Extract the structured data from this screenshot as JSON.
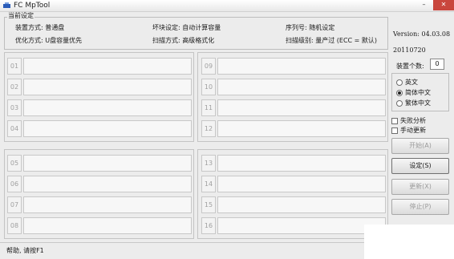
{
  "window": {
    "title": "FC MpTool",
    "minimize": "–",
    "close": "✕"
  },
  "settings": {
    "group_title": "当前设定",
    "row1": [
      "装置方式: 普通盘",
      "坏块设定: 自动计算容量",
      "序列号: 随机设定"
    ],
    "row2": [
      "优化方式: U盘容量优先",
      "扫描方式: 高级格式化",
      "扫描级别: 量产过 (ECC = 默认)"
    ]
  },
  "info": {
    "version": "Version: 04.03.08",
    "date": "20110720",
    "device_count_label": "装置个数:",
    "device_count": "0"
  },
  "language": {
    "options": [
      {
        "label": "英文",
        "selected": false
      },
      {
        "label": "简体中文",
        "selected": true
      },
      {
        "label": "繁体中文",
        "selected": false
      }
    ]
  },
  "options": {
    "failure_analysis": "失败分析",
    "manual_update": "手动更新"
  },
  "buttons": {
    "start": "开始(A)",
    "settings": "设定(S)",
    "update": "更新(X)",
    "stop": "停止(P)"
  },
  "ports": {
    "group1": [
      "01",
      "02",
      "03",
      "04"
    ],
    "group2": [
      "09",
      "10",
      "11",
      "12"
    ],
    "group3": [
      "05",
      "06",
      "07",
      "08"
    ],
    "group4": [
      "13",
      "14",
      "15",
      "16"
    ]
  },
  "status": {
    "text": "帮助, 请按F1"
  },
  "colors": {
    "close_button": "#c9463d",
    "window_bg": "#ececec"
  }
}
